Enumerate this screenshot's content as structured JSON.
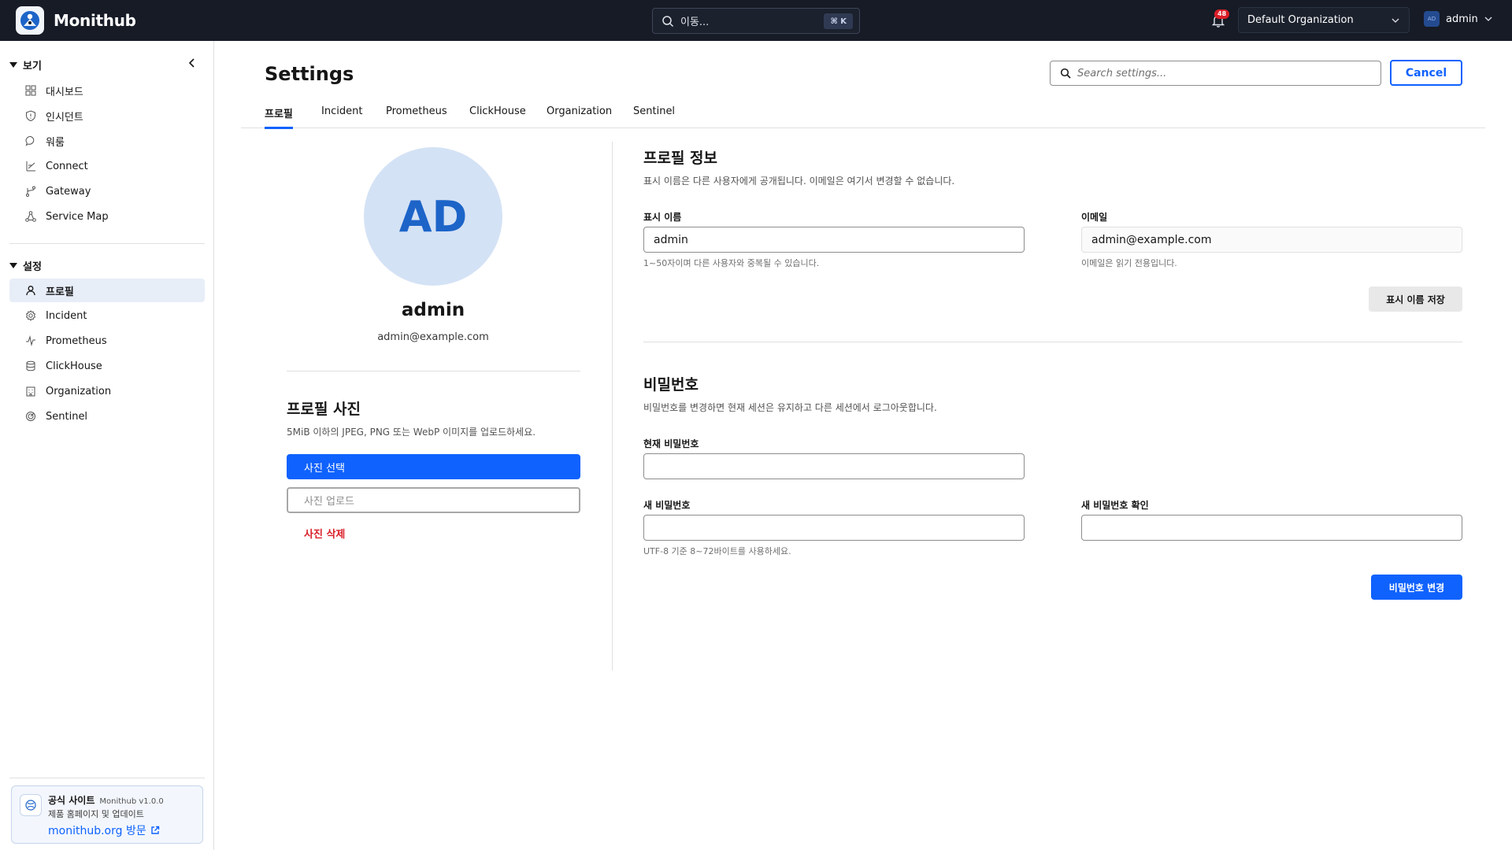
{
  "app": {
    "name": "Monithub",
    "brand_color": "#161b26",
    "accent_color": "#0f62fe"
  },
  "topbar": {
    "search_label": "이동...",
    "search_shortcut": "⌘ K",
    "notification_count": "48",
    "organization": "Default Organization",
    "user_initials": "AD",
    "user_name": "admin"
  },
  "sidebar": {
    "view_section": {
      "label": "보기",
      "items": [
        {
          "label": "대시보드",
          "icon": "dashboard-icon"
        },
        {
          "label": "인시던트",
          "icon": "shield-icon"
        },
        {
          "label": "워룸",
          "icon": "chat-bubble-icon"
        },
        {
          "label": "Connect",
          "icon": "connect-icon"
        },
        {
          "label": "Gateway",
          "icon": "branch-icon"
        },
        {
          "label": "Service Map",
          "icon": "network-icon"
        }
      ]
    },
    "settings_section": {
      "label": "설정",
      "items": [
        {
          "label": "프로필",
          "icon": "user-icon",
          "active": true
        },
        {
          "label": "Incident",
          "icon": "gear-icon"
        },
        {
          "label": "Prometheus",
          "icon": "pulse-icon"
        },
        {
          "label": "ClickHouse",
          "icon": "database-icon"
        },
        {
          "label": "Organization",
          "icon": "building-icon"
        },
        {
          "label": "Sentinel",
          "icon": "radar-icon"
        }
      ]
    },
    "promo": {
      "title": "공식 사이트",
      "version": "Monithub v1.0.0",
      "subtitle": "제품 홈페이지 및 업데이트",
      "link": "monithub.org 방문"
    }
  },
  "page": {
    "title": "Settings",
    "search_placeholder": "Search settings...",
    "cancel_label": "Cancel",
    "tabs": [
      {
        "label": "프로필",
        "active": true
      },
      {
        "label": "Incident"
      },
      {
        "label": "Prometheus"
      },
      {
        "label": "ClickHouse"
      },
      {
        "label": "Organization"
      },
      {
        "label": "Sentinel"
      }
    ]
  },
  "profile_card": {
    "initials": "AD",
    "name": "admin",
    "email": "admin@example.com",
    "photo_title": "프로필 사진",
    "photo_desc": "5MiB 이하의 JPEG, PNG 또는 WebP 이미지를 업로드하세요.",
    "select_photo": "사진 선택",
    "upload_photo": "사진 업로드",
    "delete_photo": "사진 삭제"
  },
  "profile_info": {
    "title": "프로필 정보",
    "desc": "표시 이름은 다른 사용자에게 공개됩니다. 이메일은 여기서 변경할 수 없습니다.",
    "display_name_label": "표시 이름",
    "display_name_value": "admin",
    "display_name_help": "1~50자이며 다른 사용자와 중복될 수 있습니다.",
    "email_label": "이메일",
    "email_value": "admin@example.com",
    "email_help": "이메일은 읽기 전용입니다.",
    "save_label": "표시 이름 저장"
  },
  "password": {
    "title": "비밀번호",
    "desc": "비밀번호를 변경하면 현재 세션은 유지하고 다른 세션에서 로그아웃합니다.",
    "current_label": "현재 비밀번호",
    "new_label": "새 비밀번호",
    "confirm_label": "새 비밀번호 확인",
    "help": "UTF-8 기준 8~72바이트를 사용하세요.",
    "submit_label": "비밀번호 변경"
  }
}
